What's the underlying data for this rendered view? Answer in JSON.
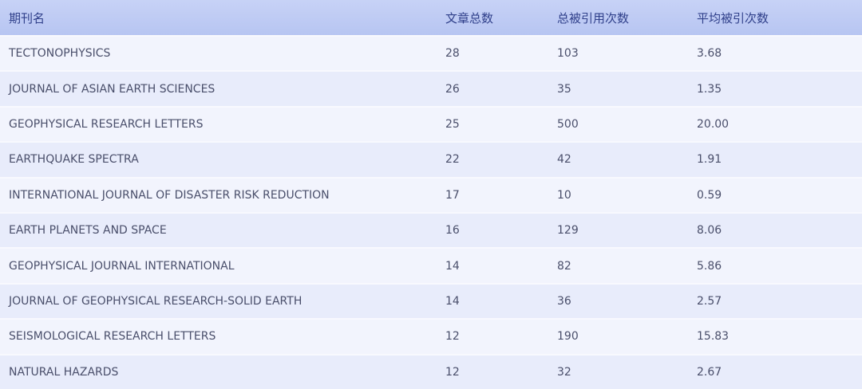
{
  "table": {
    "headers": [
      "期刊名",
      "文章总数",
      "总被引用次数",
      "平均被引次数"
    ],
    "rows": [
      [
        "TECTONOPHYSICS",
        "28",
        "103",
        "3.68"
      ],
      [
        "JOURNAL OF ASIAN EARTH SCIENCES",
        "26",
        "35",
        "1.35"
      ],
      [
        "GEOPHYSICAL RESEARCH LETTERS",
        "25",
        "500",
        "20.00"
      ],
      [
        "EARTHQUAKE SPECTRA",
        "22",
        "42",
        "1.91"
      ],
      [
        "INTERNATIONAL JOURNAL OF DISASTER RISK REDUCTION",
        "17",
        "10",
        "0.59"
      ],
      [
        "EARTH PLANETS AND SPACE",
        "16",
        "129",
        "8.06"
      ],
      [
        "GEOPHYSICAL JOURNAL INTERNATIONAL",
        "14",
        "82",
        "5.86"
      ],
      [
        "JOURNAL OF GEOPHYSICAL RESEARCH-SOLID EARTH",
        "14",
        "36",
        "2.57"
      ],
      [
        "SEISMOLOGICAL RESEARCH LETTERS",
        "12",
        "190",
        "15.83"
      ],
      [
        "NATURAL HAZARDS",
        "12",
        "32",
        "2.67"
      ]
    ]
  },
  "colors": {
    "header_bg": "#bfcbf4",
    "header_text": "#2f3f8a",
    "row_even": "#e8ecfb",
    "row_odd": "#f2f4fd",
    "body_text": "#4a4f6b"
  }
}
